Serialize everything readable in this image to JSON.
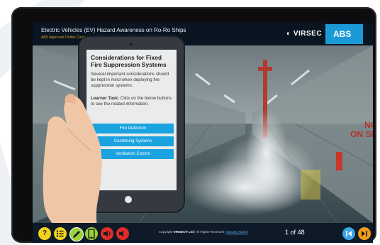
{
  "course": {
    "title": "Electric Vehicles (EV) Hazard Awareness on Ro-Ro Ships",
    "subtitle": "ABS Approved Online Course by VIRSEC"
  },
  "logos": {
    "virsec": "VIRSEC",
    "abs": "ABS"
  },
  "scene_sign": [
    "NO",
    "ON SH"
  ],
  "panel": {
    "heading": "Considerations for Fixed Fire Suppression Systems",
    "body": "Several important considerations should be kept in mind when deploying fire suppression systems:",
    "task_label": "Learner Task:",
    "task_text": " Click on the below buttons to see the related information.",
    "buttons": [
      "Fire Detection",
      "Combining Systems",
      "Ventilation Control"
    ]
  },
  "toolbar": {
    "help_icon": "question-icon",
    "menu_icon": "list-icon",
    "notes_icon": "pencil-icon",
    "device_icon": "tablet-icon",
    "audio_icon": "volume-icon",
    "mute_icon": "mute-icon",
    "colors": {
      "yellow": "#f2d21f",
      "green": "#9bd33b",
      "red": "#e12b2b",
      "blue": "#39a7e6",
      "orange": "#f29d1f"
    }
  },
  "footer": {
    "copyright_prefix": "Copyright",
    "copyright_brand": "VIRSEC® Ltd",
    "copyright_suffix": " | All Rights Reserved | ",
    "security": "Security Notice"
  },
  "pager": {
    "current": "1",
    "separator": "of",
    "total": "48"
  },
  "nav": {
    "first_icon": "skip-back-icon",
    "next_icon": "skip-forward-icon"
  }
}
